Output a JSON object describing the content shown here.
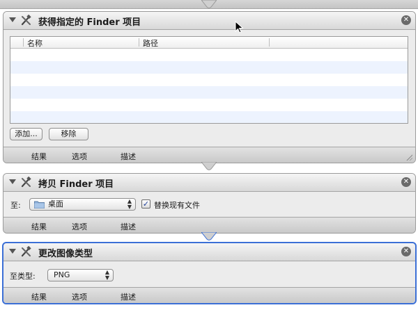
{
  "actions": [
    {
      "title": "获得指定的 Finder 项目",
      "table_headers": [
        "名称",
        "路径"
      ],
      "add_button": "添加...",
      "remove_button": "移除",
      "footer_tabs": [
        "结果",
        "选项",
        "描述"
      ]
    },
    {
      "title": "拷贝 Finder 项目",
      "to_label": "至:",
      "destination_value": "桌面",
      "replace_checkbox_label": "替换现有文件",
      "replace_checked": true,
      "footer_tabs": [
        "结果",
        "选项",
        "描述"
      ]
    },
    {
      "title": "更改图像类型",
      "type_label": "至类型:",
      "type_value": "PNG",
      "footer_tabs": [
        "结果",
        "选项",
        "描述"
      ]
    }
  ],
  "icons": {
    "action_icon": "automator-tools-icon",
    "close": "close-icon",
    "folder": "folder-icon",
    "disclosure": "disclosure-triangle-icon"
  },
  "colors": {
    "selected_border": "#3b6fd6",
    "row_alt": "#edf3fe"
  }
}
